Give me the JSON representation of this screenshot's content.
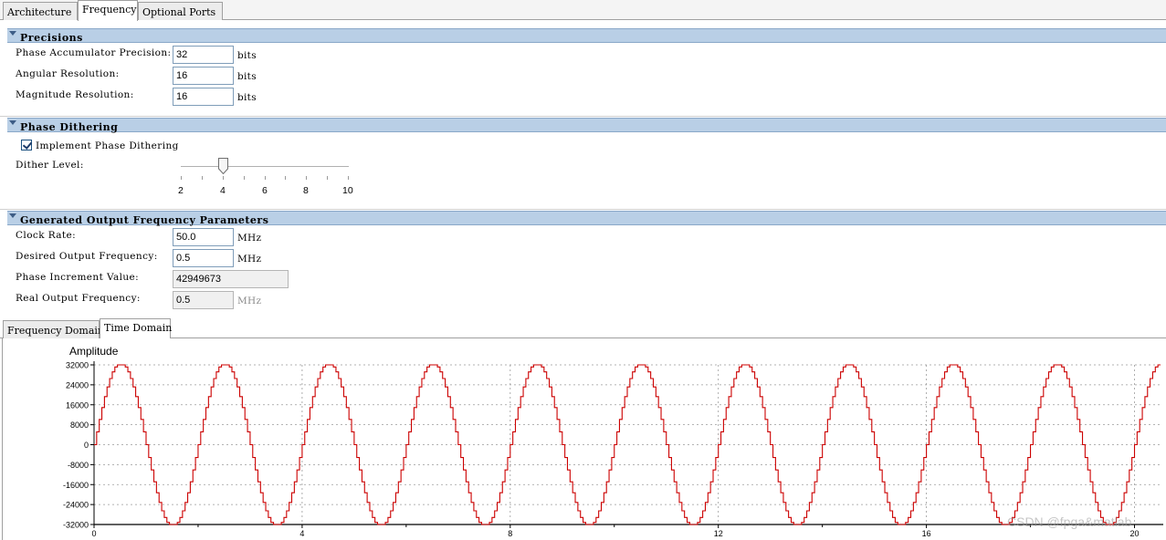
{
  "tabs": [
    "Architecture",
    "Frequency",
    "Optional Ports"
  ],
  "active_tab": "Frequency",
  "precisions": {
    "title": "Precisions",
    "phase_acc_label": "Phase Accumulator Precision:",
    "phase_acc_value": "32",
    "angular_label": "Angular Resolution:",
    "angular_value": "16",
    "magnitude_label": "Magnitude Resolution:",
    "magnitude_value": "16",
    "unit": "bits"
  },
  "dithering": {
    "title": "Phase Dithering",
    "implement_label": "Implement Phase Dithering",
    "implement_checked": true,
    "dither_label": "Dither Level:",
    "dither_value": 4,
    "dither_min": 2,
    "dither_max": 10,
    "tick_labels": [
      "2",
      "4",
      "6",
      "8",
      "10"
    ]
  },
  "output": {
    "title": "Generated Output Frequency Parameters",
    "clock_label": "Clock Rate:",
    "clock_value": "50.0",
    "desired_label": "Desired Output Frequency:",
    "desired_value": "0.5",
    "increment_label": "Phase Increment Value:",
    "increment_value": "42949673",
    "real_label": "Real Output Frequency:",
    "real_value": "0.5",
    "unit": "MHz"
  },
  "plot_tabs": [
    "Frequency Domain",
    "Time Domain"
  ],
  "active_plot_tab": "Time Domain",
  "watermark": "CSDN @fpga&matlab",
  "chart_data": {
    "type": "line",
    "ylabel": "Amplitude",
    "xlabel": "",
    "ylim": [
      -32000,
      32000
    ],
    "xlim": [
      0,
      20.5
    ],
    "y_ticks": [
      "32000",
      "24000",
      "16000",
      "8000",
      "0",
      "-8000",
      "-16000",
      "-24000",
      "-32000"
    ],
    "x_ticks": [
      "0",
      "4",
      "8",
      "12",
      "16",
      "20"
    ],
    "grid": true,
    "series": [
      {
        "function": "sine",
        "amplitude": 32767,
        "period": 2,
        "phase": 0,
        "quantization_step": 0.05,
        "color": "#cc0000"
      }
    ]
  }
}
